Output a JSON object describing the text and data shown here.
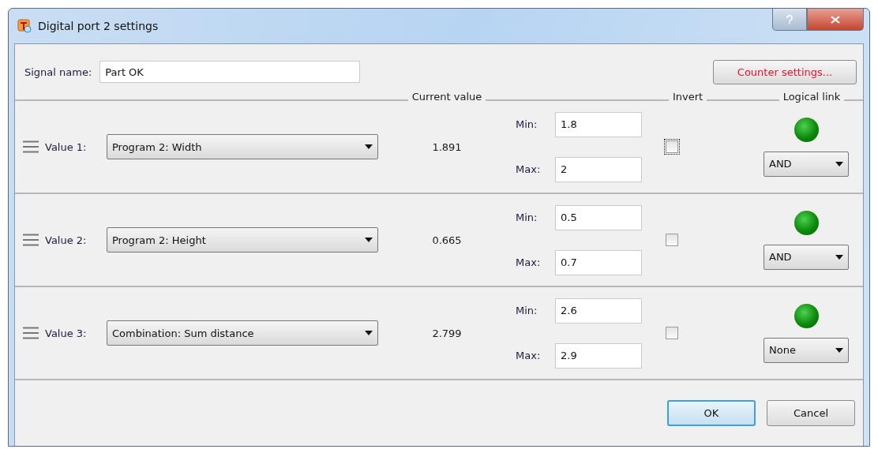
{
  "window": {
    "title": "Digital port 2 settings"
  },
  "signal_name": {
    "label": "Signal name:",
    "value": "Part OK"
  },
  "counter_button": {
    "label": "Counter settings...",
    "warning": true
  },
  "headers": {
    "current_value": "Current value",
    "invert": "Invert",
    "logical_link": "Logical link"
  },
  "rows": [
    {
      "label": "Value 1:",
      "source": "Program 2: Width",
      "current": "1.891",
      "min_label": "Min:",
      "min": "1.8",
      "max_label": "Max:",
      "max": "2",
      "invert": false,
      "focused": true,
      "lit": true,
      "link": "AND"
    },
    {
      "label": "Value 2:",
      "source": "Program 2: Height",
      "current": "0.665",
      "min_label": "Min:",
      "min": "0.5",
      "max_label": "Max:",
      "max": "0.7",
      "invert": false,
      "focused": false,
      "lit": true,
      "link": "AND"
    },
    {
      "label": "Value 3:",
      "source": "Combination: Sum distance",
      "current": "2.799",
      "min_label": "Min:",
      "min": "2.6",
      "max_label": "Max:",
      "max": "2.9",
      "invert": false,
      "focused": false,
      "lit": true,
      "link": "None"
    }
  ],
  "buttons": [
    {
      "label": "OK",
      "default": true
    },
    {
      "label": "Cancel",
      "default": false
    }
  ]
}
